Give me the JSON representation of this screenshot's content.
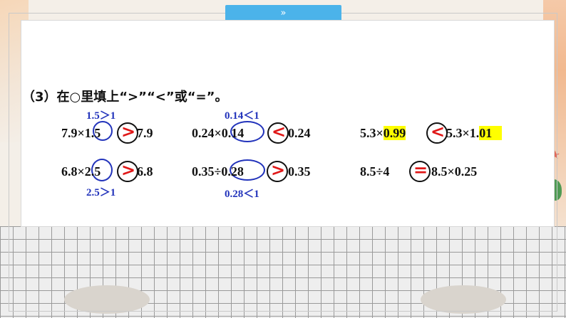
{
  "header": {
    "tab_icon": "»"
  },
  "question": {
    "title": "（3）在○里填上“>”“<”或“=”。"
  },
  "rows": {
    "r1": {
      "a_left": "7.9×1.5",
      "a_right": "7.9",
      "a_symbol": ">",
      "a_hint": "1.5＞1",
      "b_left": "0.24×0.14",
      "b_right": "0.24",
      "b_symbol": "<",
      "b_hint": "0.14＜1",
      "c_left_prefix": "5.3×",
      "c_left_hl": "0.99",
      "c_symbol": "<",
      "c_right_prefix": "5.3×1.",
      "c_right_hl": "01"
    },
    "r2": {
      "a_left": "6.8×2.5",
      "a_right": "6.8",
      "a_symbol": ">",
      "a_hint": "2.5＞1",
      "b_left": "0.35÷0.28",
      "b_right": "0.35",
      "b_symbol": ">",
      "b_hint": "0.28＜1",
      "c_left": "8.5÷4",
      "c_symbol": "=",
      "c_right": "8.5×0.25"
    }
  },
  "colors": {
    "symbol": "#e01818",
    "hint": "#2233bb",
    "highlight": "#ffff00",
    "tab": "#4bb3ea"
  }
}
